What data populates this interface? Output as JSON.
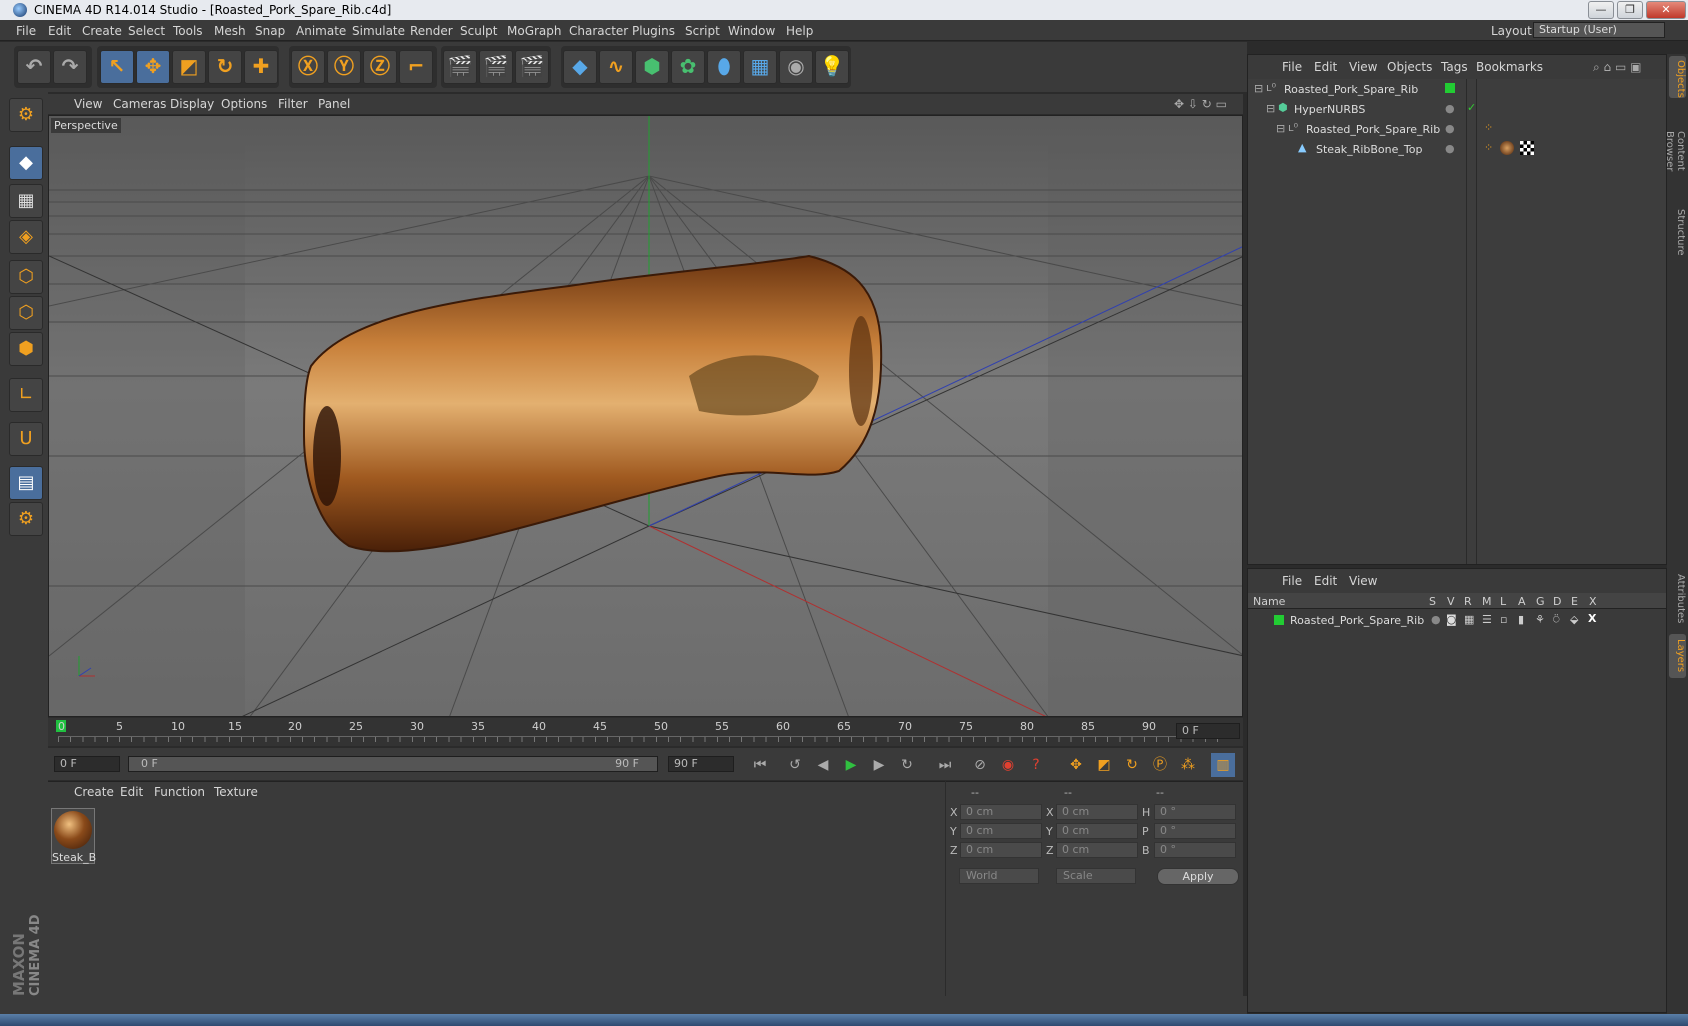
{
  "window": {
    "title": "CINEMA 4D R14.014 Studio - [Roasted_Pork_Spare_Rib.c4d]",
    "min": "—",
    "max": "❐",
    "close": "✕"
  },
  "menu": [
    "File",
    "Edit",
    "Create",
    "Select",
    "Tools",
    "Mesh",
    "Snap",
    "Animate",
    "Simulate",
    "Render",
    "Sculpt",
    "MoGraph",
    "Character",
    "Plugins",
    "Script",
    "Window",
    "Help"
  ],
  "layout": {
    "label": "Layout:",
    "value": "Startup (User)"
  },
  "viewport": {
    "menu": [
      "View",
      "Cameras",
      "Display",
      "Options",
      "Filter",
      "Panel"
    ],
    "label": "Perspective"
  },
  "timeline": {
    "ticks": [
      "0",
      "5",
      "10",
      "15",
      "20",
      "25",
      "30",
      "35",
      "40",
      "45",
      "50",
      "55",
      "60",
      "65",
      "70",
      "75",
      "80",
      "85",
      "90"
    ],
    "current_frame": "0 F",
    "start": "0 F",
    "range_start": "0 F",
    "range_end": "90 F",
    "end": "90 F"
  },
  "material_manager": {
    "menu": [
      "Create",
      "Edit",
      "Function",
      "Texture"
    ],
    "materials": [
      {
        "name": "Steak_B"
      }
    ]
  },
  "coordinates": {
    "headers": [
      "--",
      "--",
      "--"
    ],
    "rows": [
      {
        "a": "X",
        "av": "0 cm",
        "b": "X",
        "bv": "0 cm",
        "c": "H",
        "cv": "0 °"
      },
      {
        "a": "Y",
        "av": "0 cm",
        "b": "Y",
        "bv": "0 cm",
        "c": "P",
        "cv": "0 °"
      },
      {
        "a": "Z",
        "av": "0 cm",
        "b": "Z",
        "bv": "0 cm",
        "c": "B",
        "cv": "0 °"
      }
    ],
    "mode1": "World",
    "mode2": "Scale",
    "apply": "Apply"
  },
  "object_manager": {
    "menu": [
      "File",
      "Edit",
      "View",
      "Objects",
      "Tags",
      "Bookmarks"
    ],
    "objects": [
      {
        "name": "Roasted_Pork_Spare_Rib",
        "indent": 0
      },
      {
        "name": "HyperNURBS",
        "indent": 1
      },
      {
        "name": "Roasted_Pork_Spare_Rib",
        "indent": 2
      },
      {
        "name": "Steak_RibBone_Top",
        "indent": 3
      }
    ]
  },
  "layer_manager": {
    "menu": [
      "File",
      "Edit",
      "View"
    ],
    "columns": [
      "Name",
      "S",
      "V",
      "R",
      "M",
      "L",
      "A",
      "G",
      "D",
      "E",
      "X"
    ],
    "layers": [
      {
        "name": "Roasted_Pork_Spare_Rib",
        "color": "#22cc33"
      }
    ]
  },
  "side_tabs": [
    "Objects",
    "Content Browser",
    "Structure",
    "Attributes",
    "Layers"
  ],
  "branding": {
    "line1": "MAXON",
    "line2": "CINEMA 4D"
  },
  "colors": {
    "accent": "#f0a020",
    "active_tool": "#4a6e9c",
    "layer_green": "#22cc33"
  }
}
